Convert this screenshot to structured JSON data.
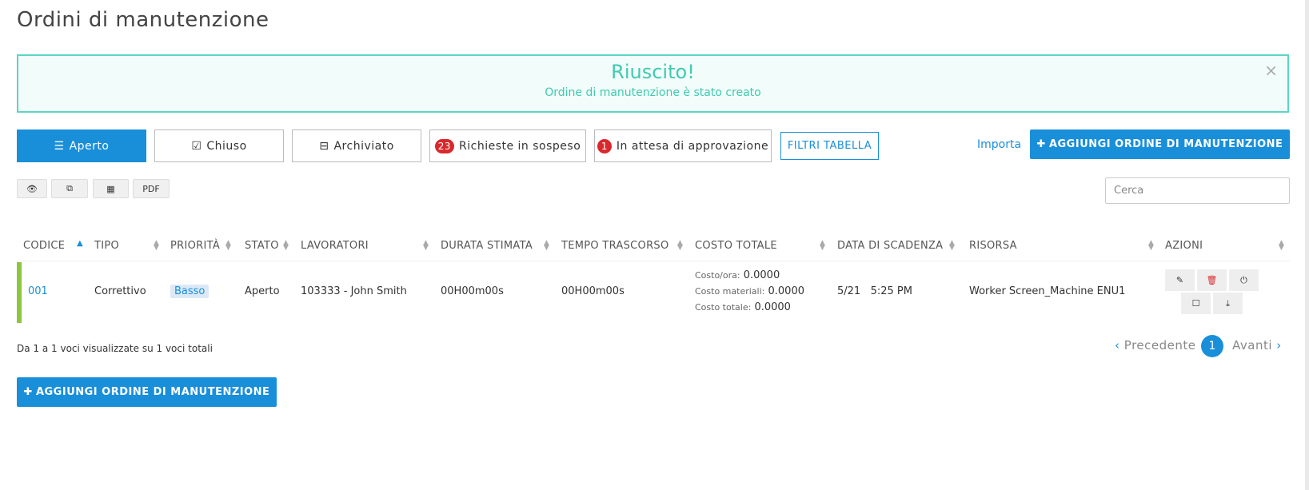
{
  "page": {
    "title": "Ordini di manutenzione"
  },
  "alert": {
    "title": "Riuscito!",
    "message": "Ordine di manutenzione è stato creato",
    "close": "×"
  },
  "tabs": [
    {
      "label": "Aperto",
      "icon": "list-icon"
    },
    {
      "label": "Chiuso",
      "icon": "check-square-icon"
    },
    {
      "label": "Archiviato",
      "icon": "inbox-icon"
    },
    {
      "label": "Richieste in sospeso",
      "badge": "23"
    },
    {
      "label": "In attesa di approvazione",
      "badge": "1"
    }
  ],
  "toolbar": {
    "filters_label": "FILTRI TABELLA",
    "import_label": "Importa",
    "add_label": "AGGIUNGI ORDINE DI MANUTENZIONE",
    "pdf_label": "PDF",
    "search_placeholder": "Cerca"
  },
  "table": {
    "columns": [
      "CODICE",
      "TIPO",
      "PRIORITÀ",
      "STATO",
      "LAVORATORI",
      "DURATA STIMATA",
      "TEMPO TRASCORSO",
      "COSTO TOTALE",
      "DATA DI SCADENZA",
      "RISORSA",
      "AZIONI"
    ],
    "rows": [
      {
        "code": "001",
        "type": "Correttivo",
        "priority": "Basso",
        "status": "Aperto",
        "workers": "103333 - John Smith",
        "estimated_duration": "00H00m00s",
        "elapsed_time": "00H00m00s",
        "cost_hour_label": "Costo/ora:",
        "cost_hour": "0.0000",
        "cost_materials_label": "Costo materiali:",
        "cost_materials": "0.0000",
        "cost_total_label": "Costo totale:",
        "cost_total": "0.0000",
        "due_date": "5/21",
        "due_time": "5:25 PM",
        "resource": "Worker Screen_Machine ENU1"
      }
    ]
  },
  "footer": {
    "info": "Da 1 a 1 voci visualizzate su 1 voci totali",
    "prev_label": "Precedente",
    "next_label": "Avanti",
    "current_page": "1"
  },
  "colors": {
    "primary": "#1a8fd9",
    "success": "#3fcab1",
    "danger": "#d9282c",
    "row_accent": "#8cc63f"
  }
}
